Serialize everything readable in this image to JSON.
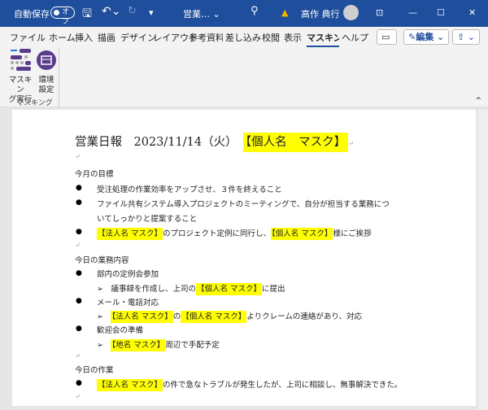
{
  "titlebar": {
    "autosave": "自動保存",
    "toggle": "オフ",
    "doc_name": "営業… ⌄",
    "user": "高作 典行",
    "warning": "▲"
  },
  "tabs": [
    "ファイル",
    "ホーム",
    "挿入",
    "描画",
    "デザイン",
    "レイアウト",
    "参考資料",
    "差し込み",
    "校閲",
    "表示",
    "マスキング",
    "ヘルプ"
  ],
  "toolbar": {
    "edit": "編集"
  },
  "ribbon": {
    "mask_run": [
      "マスキン",
      "グ実行"
    ],
    "settings": [
      "環境",
      "設定"
    ],
    "group": "マスキング"
  },
  "doc": {
    "title": "営業日報　2023/11/14（火）",
    "title_mask": "【個人名　マスク】",
    "sec1": "今月の目標",
    "b1": "受注処理の作業効率をアップさせ、３件を終えること",
    "b2a": "ファイル共有システム導入プロジェクトのミーティングで、自分が担当する業務につ",
    "b2b": "いてしっかりと提案すること",
    "b3m1": "【法人名 マスク】",
    "b3a": "のプロジェクト定例に同行し、",
    "b3m2": "【個人名 マスク】",
    "b3b": "様にご挨拶",
    "sec2": "今日の業務内容",
    "c1": "部内の定例会参加",
    "c1s": "議事録を作成し、上司の",
    "c1m": "【個人名 マスク】",
    "c1e": "に提出",
    "c2": "メール・電話対応",
    "c2m1": "【法人名 マスク】",
    "c2a": "の",
    "c2m2": "【個人名 マスク】",
    "c2e": "よりクレームの連絡があり、対応",
    "c3": "歓迎会の準備",
    "c3m": "【地名 マスク】",
    "c3e": "周辺で手配予定",
    "sec3": "今日の作業",
    "d1m": "【法人名 マスク】",
    "d1e": "の件で急なトラブルが発生したが、上司に相談し、無事解決できた。"
  },
  "colors": {
    "titlebar": "#1f4e9c",
    "highlight": "#ffff00",
    "ribbon_icon": "#5b3c8c"
  }
}
